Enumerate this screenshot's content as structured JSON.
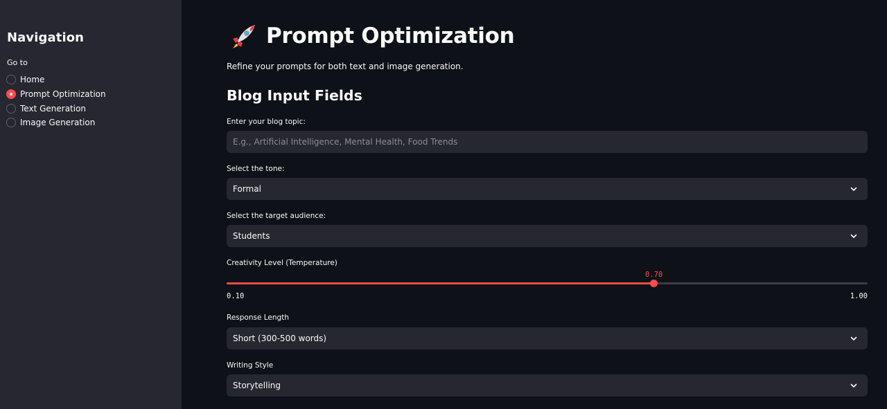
{
  "sidebar": {
    "title": "Navigation",
    "radio_label": "Go to",
    "options": [
      {
        "label": "Home",
        "selected": false
      },
      {
        "label": "Prompt Optimization",
        "selected": true
      },
      {
        "label": "Text Generation",
        "selected": false
      },
      {
        "label": "Image Generation",
        "selected": false
      }
    ]
  },
  "header": {
    "icon": "rocket-icon",
    "title": "Prompt Optimization",
    "subtitle": "Refine your prompts for both text and image generation."
  },
  "section": {
    "title": "Blog Input Fields"
  },
  "fields": {
    "topic": {
      "label": "Enter your blog topic:",
      "value": "",
      "placeholder": "E.g., Artificial Intelligence, Mental Health, Food Trends"
    },
    "tone": {
      "label": "Select the tone:",
      "value": "Formal"
    },
    "audience": {
      "label": "Select the target audience:",
      "value": "Students"
    },
    "creativity": {
      "label": "Creativity Level (Temperature)",
      "value": 0.7,
      "value_display": "0.70",
      "min": 0.1,
      "min_display": "0.10",
      "max": 1.0,
      "max_display": "1.00"
    },
    "length": {
      "label": "Response Length",
      "value": "Short (300-500 words)"
    },
    "style": {
      "label": "Writing Style",
      "value": "Storytelling"
    }
  },
  "colors": {
    "accent": "#ff4b4b",
    "background": "#0e1117",
    "sidebar": "#262730",
    "widget": "#262730",
    "text": "#fafafa"
  }
}
